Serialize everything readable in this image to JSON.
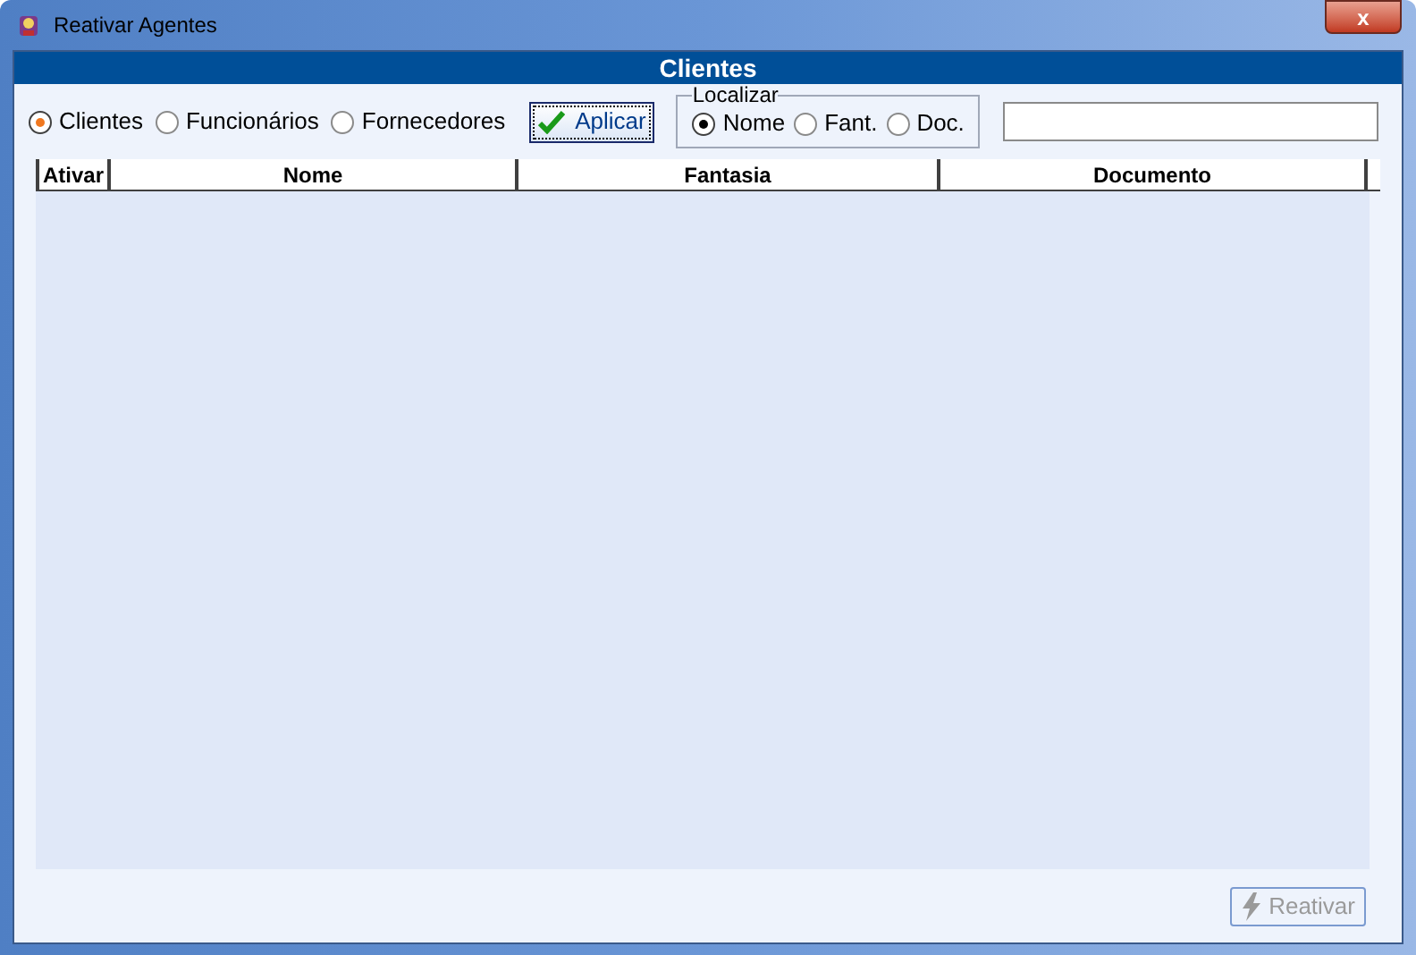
{
  "window": {
    "title": "Reativar Agentes",
    "close": "x"
  },
  "header": "Clientes",
  "agent_types": [
    {
      "label": "Clientes",
      "selected": true
    },
    {
      "label": "Funcionários",
      "selected": false
    },
    {
      "label": "Fornecedores",
      "selected": false
    }
  ],
  "apply_button": "Aplicar",
  "search_group": {
    "title": "Localizar",
    "options": [
      {
        "label": "Nome",
        "selected": true
      },
      {
        "label": "Fant.",
        "selected": false
      },
      {
        "label": "Doc.",
        "selected": false
      }
    ]
  },
  "table": {
    "columns": [
      "Ativar",
      "Nome",
      "Fantasia",
      "Documento"
    ]
  },
  "reactivate_button": {
    "label": "Reativar",
    "disabled": true
  }
}
